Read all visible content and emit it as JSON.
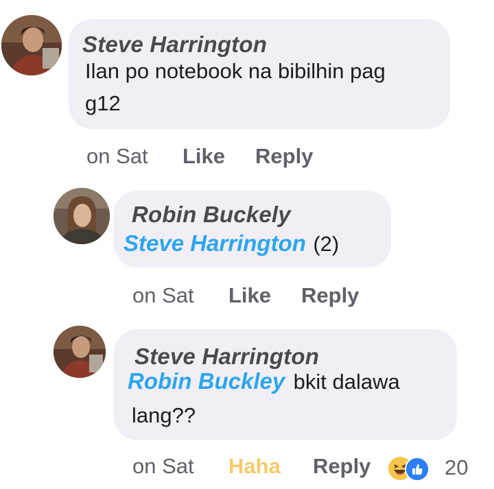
{
  "comments": [
    {
      "author": "Steve Harrington",
      "mention": "",
      "text_line1": "Ilan po notebook na bibilhin pag",
      "text_line2": "g12",
      "time": "on Sat",
      "like": "Like",
      "reply": "Reply"
    },
    {
      "author": "Robin Buckely",
      "mention": "Steve Harrington",
      "text": "(2)",
      "time": "on Sat",
      "like": "Like",
      "reply": "Reply"
    },
    {
      "author": "Steve Harrington",
      "mention": "Robin Buckley",
      "text_line1": "bkit dalawa",
      "text_line2": "lang??",
      "time": "on Sat",
      "like": "Haha",
      "reply": "Reply",
      "reactions": [
        "haha-icon",
        "like-icon"
      ],
      "reaction_count": "20"
    }
  ],
  "colors": {
    "bubble": "#f1eff5",
    "mention": "#2ea5ec",
    "haha": "#f3cc6a",
    "meta": "#606068"
  }
}
